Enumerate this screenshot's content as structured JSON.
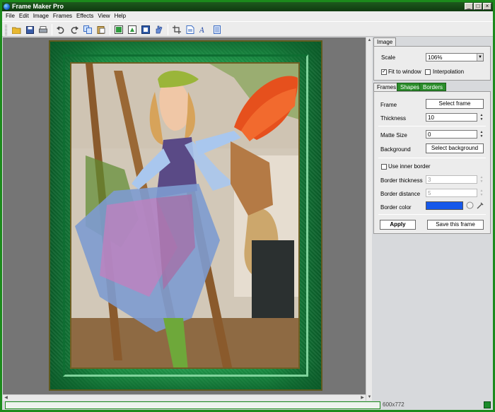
{
  "app": {
    "title": "Frame Maker Pro"
  },
  "window_buttons": {
    "minimize": "_",
    "maximize": "□",
    "close": "×"
  },
  "menu": {
    "items": [
      "File",
      "Edit",
      "Image",
      "Frames",
      "Effects",
      "View",
      "Help"
    ]
  },
  "toolbar": {
    "icons": [
      "open-folder-icon",
      "save-icon",
      "print-icon",
      "undo-icon",
      "redo-icon",
      "copy-icon",
      "paste-icon",
      "image-icon",
      "export-icon",
      "frame-icon",
      "hand-icon",
      "crop-icon",
      "document-icon",
      "text-icon",
      "page-icon"
    ]
  },
  "panel": {
    "image_tab": "Image",
    "scale_label": "Scale",
    "scale_value": "106%",
    "fit_to_window_label": "Fit to window",
    "fit_to_window_checked": true,
    "interpolation_label": "Interpolation",
    "interpolation_checked": false,
    "subtabs": [
      "Frames",
      "Shapes",
      "Borders"
    ],
    "frame_label": "Frame",
    "select_frame_button": "Select frame",
    "thickness_label": "Thickness",
    "thickness_value": "10",
    "matte_size_label": "Matte Size",
    "matte_size_value": "0",
    "background_label": "Background",
    "select_background_button": "Select background",
    "use_inner_border_label": "Use inner border",
    "use_inner_border_checked": false,
    "border_thickness_label": "Border thickness",
    "border_thickness_value": "3",
    "border_distance_label": "Border distance",
    "border_distance_value": "5",
    "border_color_label": "Border color",
    "border_color": "#1658ea",
    "apply_button": "Apply",
    "save_frame_button": "Save this frame"
  },
  "status": {
    "dimensions": "600x772"
  },
  "colors": {
    "accent_green": "#1c8a1c",
    "frame_green": "#1d9a49"
  }
}
